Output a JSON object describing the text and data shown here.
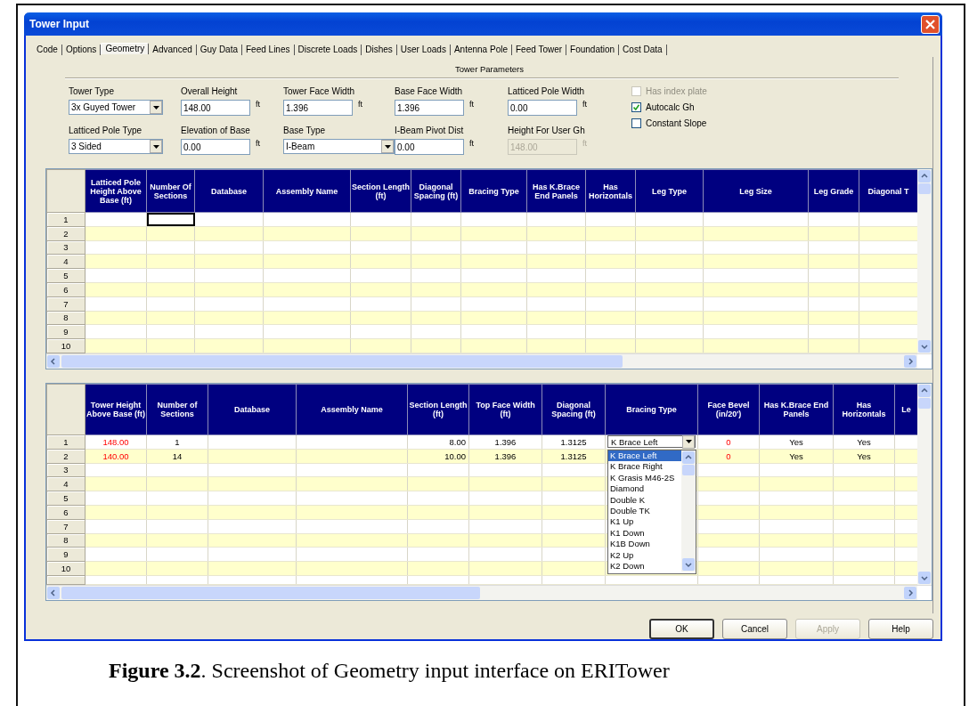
{
  "window": {
    "title": "Tower Input"
  },
  "tabs": [
    {
      "label": "Code",
      "selected": false
    },
    {
      "label": "Options",
      "selected": false
    },
    {
      "label": "Geometry",
      "selected": true
    },
    {
      "label": "Advanced",
      "selected": false
    },
    {
      "label": "Guy Data",
      "selected": false
    },
    {
      "label": "Feed Lines",
      "selected": false
    },
    {
      "label": "Discrete Loads",
      "selected": false
    },
    {
      "label": "Dishes",
      "selected": false
    },
    {
      "label": "User Loads",
      "selected": false
    },
    {
      "label": "Antenna Pole",
      "selected": false
    },
    {
      "label": "Feed Tower",
      "selected": false
    },
    {
      "label": "Foundation",
      "selected": false
    },
    {
      "label": "Cost Data",
      "selected": false
    }
  ],
  "section_title": "Tower Parameters",
  "fields": [
    {
      "label": "Tower Type",
      "kind": "dropdown",
      "value": "3x Guyed Tower",
      "disabled": false
    },
    {
      "label": "Overall Height",
      "kind": "input",
      "value": "148.00",
      "unit": "ft",
      "disabled": false
    },
    {
      "label": "Tower Face Width",
      "kind": "input",
      "value": "1.396",
      "unit": "ft",
      "disabled": false
    },
    {
      "label": "Base Face Width",
      "kind": "input",
      "value": "1.396",
      "unit": "ft",
      "disabled": false
    },
    {
      "label": "Latticed Pole Width",
      "kind": "input",
      "value": "0.00",
      "unit": "ft",
      "disabled": false
    },
    {
      "label": "Latticed Pole Type",
      "kind": "dropdown",
      "value": "3 Sided",
      "disabled": false
    },
    {
      "label": "Elevation of Base",
      "kind": "input",
      "value": "0.00",
      "unit": "ft",
      "disabled": false
    },
    {
      "label": "Base Type",
      "kind": "dropdown",
      "value": "I-Beam",
      "disabled": false
    },
    {
      "label": "I-Beam Pivot Dist",
      "kind": "input",
      "value": "0.00",
      "unit": "ft",
      "disabled": false
    },
    {
      "label": "Height For User Gh",
      "kind": "input",
      "value": "148.00",
      "unit": "ft",
      "disabled": true
    }
  ],
  "checkboxes": [
    {
      "label": "Has index plate",
      "checked": false,
      "disabled": true
    },
    {
      "label": "Autocalc Gh",
      "checked": true,
      "disabled": false
    },
    {
      "label": "Constant Slope",
      "checked": false,
      "disabled": false
    }
  ],
  "latticed_pole_grid": {
    "columns": [
      "Latticed Pole Height Above Base (ft)",
      "Number Of Sections",
      "Database",
      "Assembly Name",
      "Section Length (ft)",
      "Diagonal Spacing (ft)",
      "Bracing Type",
      "Has K.Brace End Panels",
      "Has Horizontals",
      "Leg Type",
      "Leg Size",
      "Leg Grade",
      "Diagonal T"
    ],
    "rows": [
      {
        "number": "1",
        "cells": [
          null,
          {
            "kind": "focus"
          }
        ]
      },
      {
        "number": "2"
      },
      {
        "number": "3"
      },
      {
        "number": "4"
      },
      {
        "number": "5"
      },
      {
        "number": "6"
      },
      {
        "number": "7"
      },
      {
        "number": "8"
      },
      {
        "number": "9"
      },
      {
        "number": "10"
      }
    ]
  },
  "tower_grid": {
    "columns": [
      "Tower Height Above Base (ft)",
      "Number of Sections",
      "Database",
      "Assembly Name",
      "Section Length (ft)",
      "Top Face Width (ft)",
      "Diagonal Spacing (ft)",
      "Bracing Type",
      "Face Bevel (in/20')",
      "Has K.Brace End Panels",
      "Has Horizontals",
      "Le"
    ],
    "rows": [
      {
        "number": "1",
        "cells": [
          {
            "kind": "warning",
            "text": "148.00"
          },
          "1",
          null,
          null,
          "8.00",
          "1.396",
          "1.3125",
          {
            "kind": "combo",
            "text": "K Brace Left",
            "options": [
              {
                "label": "K Brace Left",
                "selected": true
              },
              {
                "label": "K Brace Right",
                "selected": false
              },
              {
                "label": "K Grasis M46-2S",
                "selected": false
              },
              {
                "label": "Diamond",
                "selected": false
              },
              {
                "label": "Double K",
                "selected": false
              },
              {
                "label": "Double TK",
                "selected": false
              },
              {
                "label": "K1 Up",
                "selected": false
              },
              {
                "label": "K1 Down",
                "selected": false
              },
              {
                "label": "K1B Down",
                "selected": false
              },
              {
                "label": "K2 Up",
                "selected": false
              },
              {
                "label": "K2 Down",
                "selected": false
              }
            ]
          },
          {
            "kind": "warning",
            "text": "0"
          },
          "Yes",
          "Yes",
          null
        ]
      },
      {
        "number": "2",
        "cells": [
          {
            "kind": "warning",
            "text": "140.00"
          },
          "14",
          null,
          null,
          "10.00",
          "1.396",
          "1.3125",
          null,
          {
            "kind": "warning",
            "text": "0"
          },
          "Yes",
          "Yes",
          null
        ]
      },
      {
        "number": "3"
      },
      {
        "number": "4"
      },
      {
        "number": "5"
      },
      {
        "number": "6"
      },
      {
        "number": "7"
      },
      {
        "number": "8"
      },
      {
        "number": "9"
      },
      {
        "number": "10"
      }
    ]
  },
  "buttons": [
    {
      "label": "OK",
      "default": true,
      "disabled": false
    },
    {
      "label": "Cancel",
      "default": false,
      "disabled": false
    },
    {
      "label": "Apply",
      "default": false,
      "disabled": true
    },
    {
      "label": "Help",
      "default": false,
      "disabled": false
    }
  ],
  "caption": "**Figure 3.2**.  Screenshot of Geometry input interface on ERITower"
}
